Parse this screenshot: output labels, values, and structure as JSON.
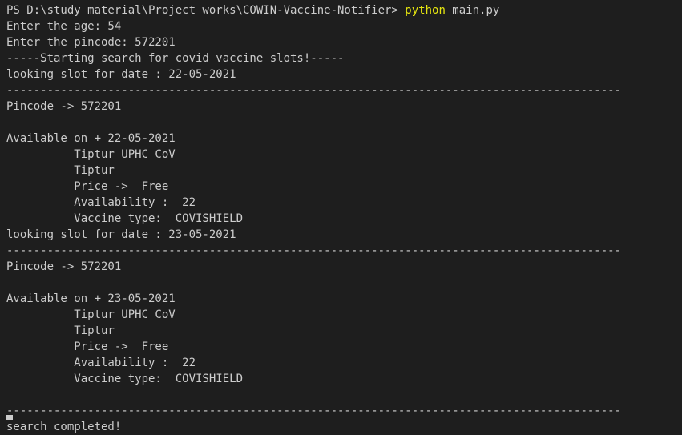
{
  "terminal": {
    "prompt": "PS D:\\study material\\Project works\\COWIN-Vaccine-Notifier> ",
    "command": "python",
    "command_args": " main.py",
    "lines": [
      "Enter the age: 54",
      "Enter the pincode: 572201",
      "-----Starting search for covid vaccine slots!-----",
      "looking slot for date : 22-05-2021",
      "-------------------------------------------------------------------------------------------",
      "Pincode -> 572201",
      "",
      "Available on + 22-05-2021",
      "          Tiptur UPHC CoV",
      "          Tiptur",
      "          Price ->  Free",
      "          Availability :  22",
      "          Vaccine type:  COVISHIELD",
      "looking slot for date : 23-05-2021",
      "-------------------------------------------------------------------------------------------",
      "Pincode -> 572201",
      "",
      "Available on + 23-05-2021",
      "          Tiptur UPHC CoV",
      "          Tiptur",
      "          Price ->  Free",
      "          Availability :  22",
      "          Vaccine type:  COVISHIELD",
      "",
      "-------------------------------------------------------------------------------------------",
      "search completed!"
    ]
  },
  "colors": {
    "background": "#1e1e1e",
    "text": "#cccccc",
    "command": "#e5e510"
  }
}
